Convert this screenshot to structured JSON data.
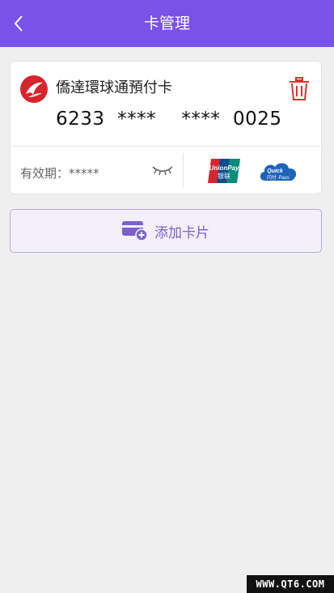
{
  "header": {
    "title": "卡管理",
    "back_icon": "chevron-left-icon",
    "background": "#7a52e8"
  },
  "card": {
    "bank_name": "僑達環球通預付卡",
    "card_number": "6233  ****    ****  0025",
    "validity": "有效期：*****",
    "bank_logo_icon": "bank-logo-icon",
    "delete_icon": "trash-icon",
    "eye_icon": "eye-closed-icon",
    "unionpay_logo": {
      "line1": "UnionPay",
      "line2": "银联"
    },
    "quickpass_logo": {
      "line1": "Quick",
      "line2": "Pass",
      "cn": "闪付"
    },
    "delete_color": "#e0322d"
  },
  "add_card": {
    "label": "添加卡片",
    "icon": "add-card-icon",
    "accent": "#7a62c8"
  },
  "watermark": "WWW.QT6.COM"
}
